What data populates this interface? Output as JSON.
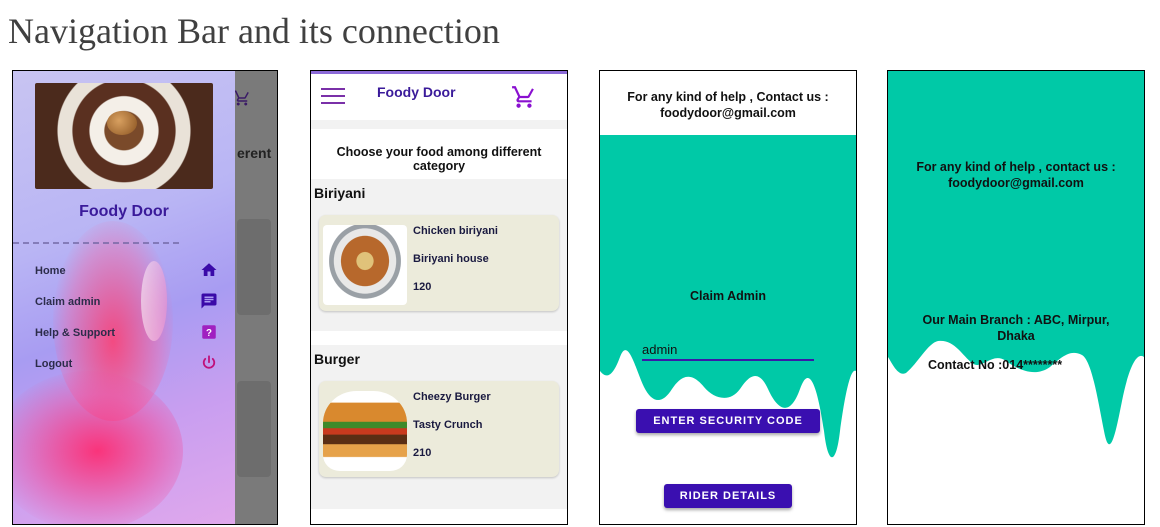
{
  "heading": "Navigation Bar and its connection",
  "colors": {
    "accent_purple": "#3a0fb0",
    "teal": "#00c9a7",
    "cart_purple": "#8a10d0"
  },
  "drawer_screen": {
    "brand": "Foody Door",
    "background_partial_text": "erent",
    "menu": [
      {
        "label": "Home",
        "icon": "home-icon"
      },
      {
        "label": "Claim admin",
        "icon": "message-icon"
      },
      {
        "label": "Help & Support",
        "icon": "help-icon"
      },
      {
        "label": "Logout",
        "icon": "power-icon"
      }
    ]
  },
  "home_screen": {
    "title": "Foody Door",
    "subtitle": "Choose your food among different category",
    "categories": [
      {
        "name": "Biriyani",
        "item": "Chicken biriyani",
        "shop": "Biriyani house",
        "price": "120"
      },
      {
        "name": "Burger",
        "item": "Cheezy Burger",
        "shop": "Tasty Crunch",
        "price": "210"
      }
    ]
  },
  "claim_screen": {
    "help_line1": "For any kind of help , Contact us :",
    "help_line2": "foodydoor@gmail.com",
    "claim_title": "Claim Admin",
    "input_value": "admin",
    "enter_code_button": "ENTER SECURITY CODE",
    "rider_button": "RIDER DETAILS"
  },
  "support_screen": {
    "help_line1": "For any kind of help , contact us :",
    "help_line2": "foodydoor@gmail.com",
    "branch_line1": "Our Main Branch : ABC, Mirpur,",
    "branch_line2": "Dhaka",
    "contact": "Contact No :014********"
  }
}
